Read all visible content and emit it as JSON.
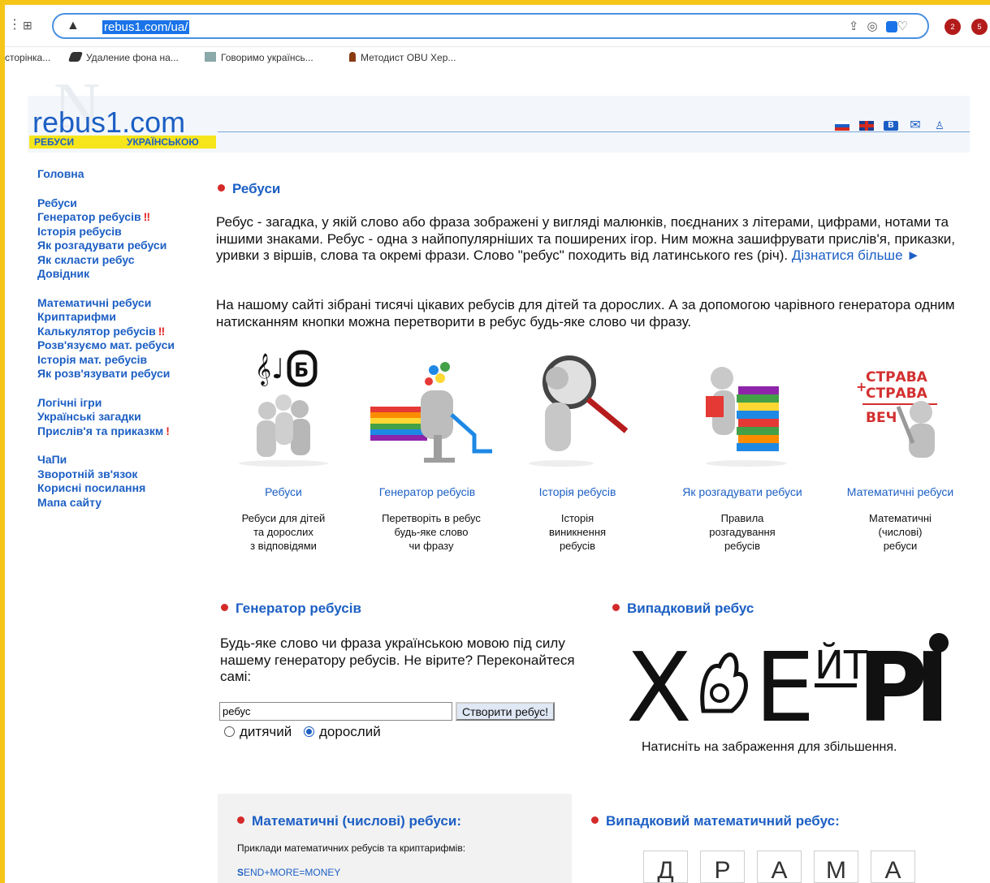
{
  "browser": {
    "url": "rebus1.com/ua/",
    "bookmarks": [
      "сторінка...",
      "Удаление фона на...",
      "Говоримо українсь...",
      "Методист OBU Хер..."
    ],
    "ext_badges": [
      "2",
      "5"
    ]
  },
  "site": {
    "logo_text": "rebus1.com",
    "logo_bar_left": "РЕБУСИ",
    "logo_bar_right": "УКРАЇНСЬКОЮ",
    "sidebar": {
      "group1": [
        "Головна"
      ],
      "group2": [
        "Ребуси",
        "Генератор ребусів",
        "Історія ребусів",
        "Як розгадувати ребуси",
        "Як скласти ребус",
        "Довідник"
      ],
      "group3": [
        "Математичні ребуси",
        "Криптарифми",
        "Калькулятор ребусів",
        "Розв'язуємо мат. ребуси",
        "Історія мат. ребусів",
        "Як розв'язувати ребуси"
      ],
      "group4": [
        "Логічні ігри",
        "Українські загадки",
        "Прислів'я та приказкм"
      ],
      "group5": [
        "ЧаПи",
        "Зворотній зв'язок",
        "Корисні посилання",
        "Мапа сайту"
      ],
      "excl": "‼",
      "excl_single": "!"
    },
    "rebuses_title": "Ребуси",
    "intro_p1": "Ребус - загадка, у якій слово або фраза зображені у вигляді малюнків, поєднаних з літерами, цифрами, нотами та іншими знаками. Ребус - одна з найпопулярніших та поширених ігор. Ним можна зашифрувати прислів'я, приказки, уривки з віршів, слова та окремі фрази. Слово \"ребус\" походить від латинського res (річ).",
    "more_link": "Дізнатися більше ►",
    "intro_p2": "На нашому сайті зібрані тисячі цікавих ребусів для дітей та дорослих. А за допомогою чарівного генератора одним натисканням кнопки можна перетворити в ребус будь-яке слово чи фразу.",
    "cards": [
      {
        "link": "Ребуси",
        "desc": [
          "Ребуси для дітей",
          "та дорослих",
          "з відповідями"
        ]
      },
      {
        "link": "Генератор ребусів",
        "desc": [
          "Перетворіть в ребус",
          "будь-яке слово",
          "чи фразу"
        ]
      },
      {
        "link": "Історія ребусів",
        "desc": [
          "Історія",
          "виникнення",
          "ребусів"
        ]
      },
      {
        "link": "Як розгадувати ребуси",
        "desc": [
          "Правила",
          "розгадування",
          "ребусів"
        ]
      },
      {
        "link": "Математичні ребуси",
        "desc": [
          "Математичні",
          "(числові)",
          "ребуси"
        ]
      }
    ],
    "card_art": {
      "notes": "𝄞♩",
      "letter": "Б",
      "strava1": "СТРАВА",
      "strava2": "СТРАВА",
      "strava3": "ВЕЧ"
    },
    "generator": {
      "title": "Генератор ребусів",
      "text": "Будь-яке слово чи фраза українською мовою під силу нашему генератору ребусів. Не вірите? Переконайтеся самі:",
      "input_value": "ребус",
      "button": "Створити ребус!",
      "radio_kids": "дитячий",
      "radio_adult": "дорослий"
    },
    "random": {
      "title": "Випадковий ребус",
      "rebus_text": "Х",
      "rebus_text2": "Е",
      "rebus_text3": "ЙТ",
      "rebus_text4": "Р",
      "rebus_text5": "І",
      "caption": "Натисніть на забраження для збільшення."
    },
    "math": {
      "title": "Математичні (числові) ребуси:",
      "subtitle": "Приклади математичних ребусів та криптарифмів:",
      "example_first": "S",
      "example_rest": "END+MORE=MONEY"
    },
    "random_math": {
      "title": "Випадковий математичний ребус:",
      "tiles": [
        "Д",
        "Р",
        "А",
        "М",
        "А"
      ]
    }
  }
}
